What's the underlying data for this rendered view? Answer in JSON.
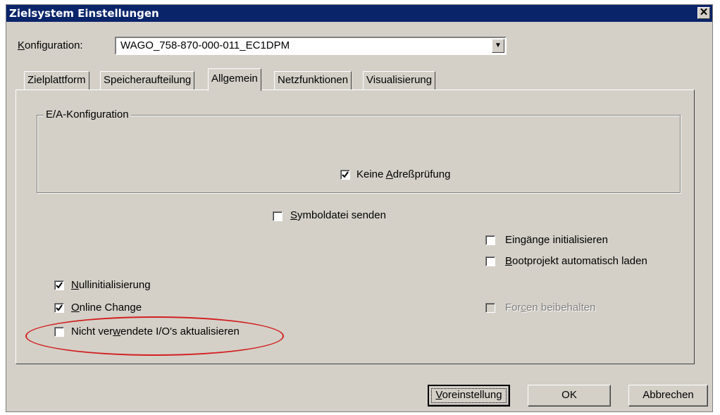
{
  "window": {
    "title": "Zielsystem Einstellungen",
    "close_symbol": "✕"
  },
  "konfiguration": {
    "label_prefix": "K",
    "label_rest": "onfiguration:",
    "value": "WAGO_758-870-000-011_EC1DPM"
  },
  "tabs": [
    {
      "label": "Zielplattform",
      "active": false
    },
    {
      "label": "Speicheraufteilung",
      "active": false
    },
    {
      "label": "Allgemein",
      "active": true
    },
    {
      "label": "Netzfunktionen",
      "active": false
    },
    {
      "label": "Visualisierung",
      "active": false
    }
  ],
  "group": {
    "legend": "E/A-Konfiguration"
  },
  "checkboxes": {
    "keine_adresspruefung": {
      "pre": "Keine ",
      "u": "A",
      "post": "dreßprüfung",
      "checked": true
    },
    "symboldatei_senden": {
      "pre": "",
      "u": "S",
      "post": "ymboldatei senden",
      "checked": false
    },
    "eingaenge_initialisieren": {
      "pre": "Ein",
      "u": "g",
      "post": "änge initialisieren",
      "checked": false
    },
    "bootprojekt_laden": {
      "pre": "",
      "u": "B",
      "post": "ootprojekt automatisch laden",
      "checked": false
    },
    "nullinitialisierung": {
      "pre": "",
      "u": "N",
      "post": "ullinitialisierung",
      "checked": true
    },
    "online_change": {
      "pre": "",
      "u": "O",
      "post": "nline Change",
      "checked": true
    },
    "forcen_beibehalten": {
      "pre": "For",
      "u": "c",
      "post": "en beibehalten",
      "checked": false,
      "disabled": true
    },
    "nicht_verwendete_io": {
      "pre": "Nicht ver",
      "u": "w",
      "post": "endete I/O's aktualisieren",
      "checked": false
    }
  },
  "buttons": {
    "voreinstellung": {
      "u": "V",
      "rest": "oreinstellung"
    },
    "ok": "OK",
    "abbrechen": "Abbrechen"
  },
  "annotation": {
    "color": "#d31f1f"
  },
  "colors": {
    "titlebar": "#0a246a",
    "face": "#d4d0c8"
  }
}
